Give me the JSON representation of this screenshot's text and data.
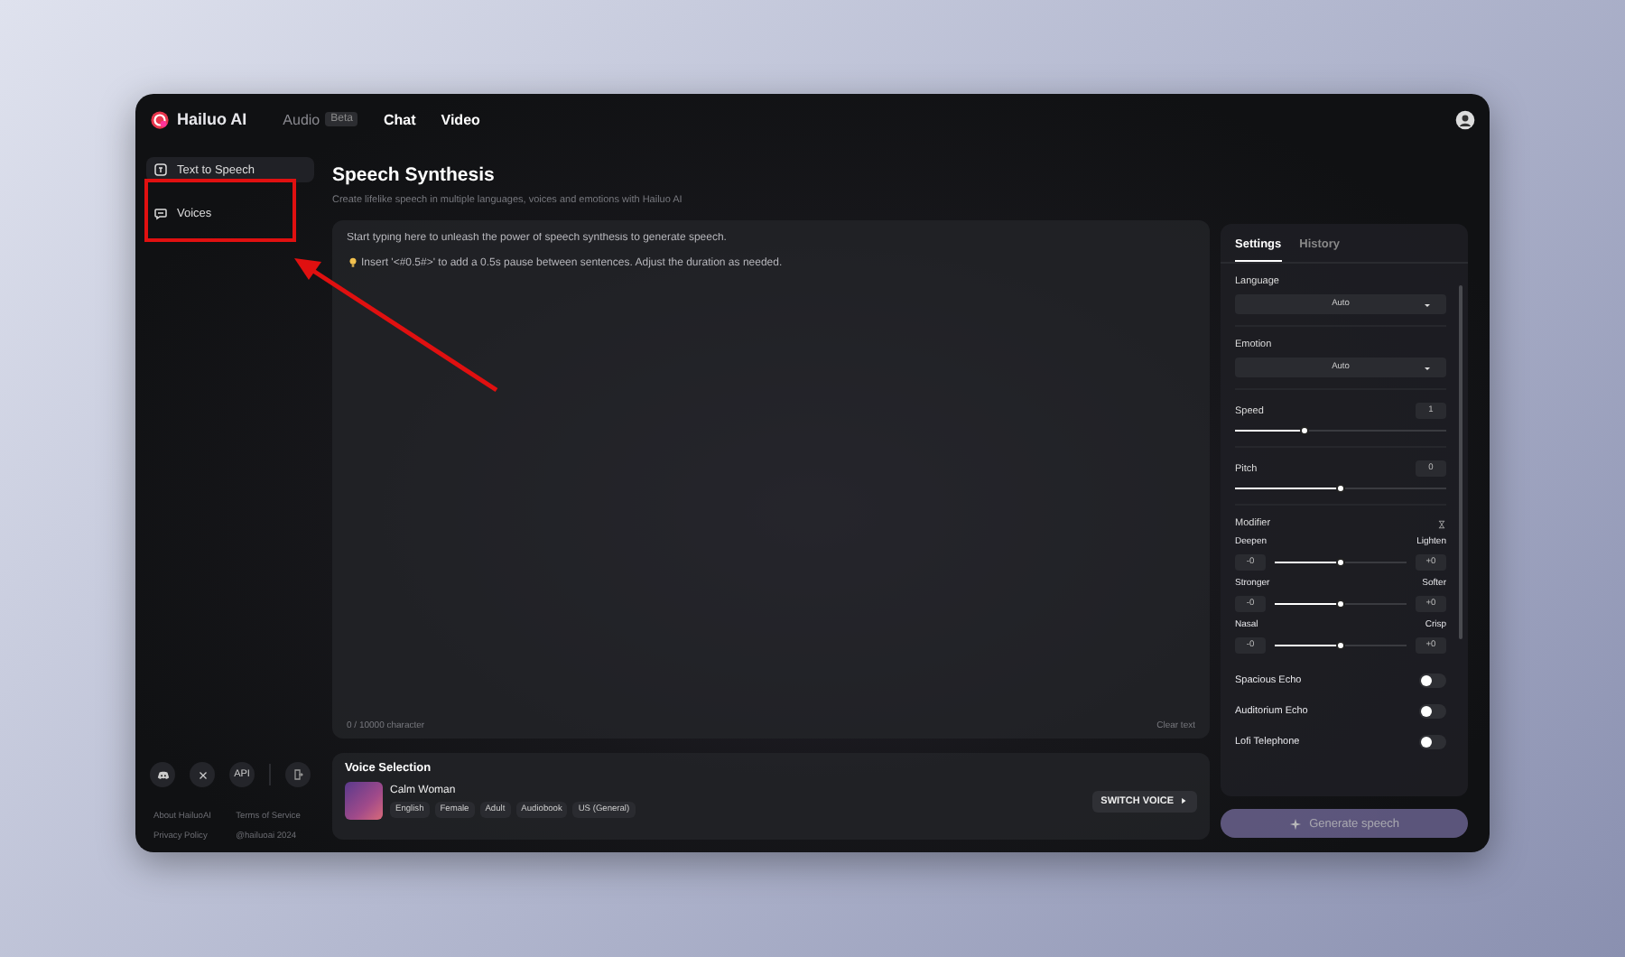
{
  "nav": {
    "brand": "Hailuo AI",
    "tabs": [
      {
        "label": "Audio",
        "badge": "Beta",
        "selected": true
      },
      {
        "label": "Chat",
        "selected": false
      },
      {
        "label": "Video",
        "selected": false
      }
    ]
  },
  "sidebar": {
    "items": [
      {
        "label": "Text to Speech",
        "kind": "speech",
        "selected": true
      },
      {
        "label": "Voices",
        "kind": "voices",
        "selected": false
      }
    ],
    "socials": [
      {
        "kind": "discord"
      },
      {
        "kind": "x"
      },
      {
        "kind": "api",
        "label": "API"
      },
      {
        "kind": "exit"
      }
    ],
    "footer_links": [
      "About HailuoAI",
      "Terms of Service",
      "Privacy Policy",
      "@hailuoai 2024"
    ]
  },
  "main": {
    "title": "Speech Synthesis",
    "subtitle": "Create lifelike speech in multiple languages, voices and emotions with Hailuo AI",
    "editor": {
      "placeholder": "Start typing here to unleash the power of speech synthesis to generate speech.",
      "hint": "Insert '<#0.5#>' to add a 0.5s pause between sentences. Adjust the duration as needed.",
      "counter": "0 / 10000 character",
      "clear": "Clear text"
    },
    "voice_selection": {
      "title": "Voice Selection",
      "name": "Calm Woman",
      "tags": [
        "English",
        "Female",
        "Adult",
        "Audiobook",
        "US (General)"
      ],
      "button": "SWITCH VOICE"
    }
  },
  "settings": {
    "tabs": [
      {
        "label": "Settings",
        "selected": true
      },
      {
        "label": "History",
        "selected": false
      }
    ],
    "dropdowns": [
      {
        "label": "Language",
        "value": "Auto"
      },
      {
        "label": "Emotion",
        "value": "Auto"
      }
    ],
    "sliders": [
      {
        "label": "Speed",
        "reading": "1",
        "level": 0.33
      },
      {
        "label": "Pitch",
        "reading": "0",
        "level": 0.5
      }
    ],
    "modifier": {
      "title": "Modifier",
      "rows": [
        {
          "left": "Deepen",
          "right": "Lighten",
          "left_value": "-0",
          "right_value": "+0",
          "level": 0.5
        },
        {
          "left": "Stronger",
          "right": "Softer",
          "left_value": "-0",
          "right_value": "+0",
          "level": 0.5
        },
        {
          "left": "Nasal",
          "right": "Crisp",
          "left_value": "-0",
          "right_value": "+0",
          "level": 0.5
        }
      ]
    },
    "toggles": [
      {
        "label": "Spacious Echo",
        "on": false
      },
      {
        "label": "Auditorium Echo",
        "on": false
      },
      {
        "label": "Lofi Telephone",
        "on": false
      }
    ],
    "generate": {
      "label": "Generate speech",
      "disabled": true
    }
  }
}
